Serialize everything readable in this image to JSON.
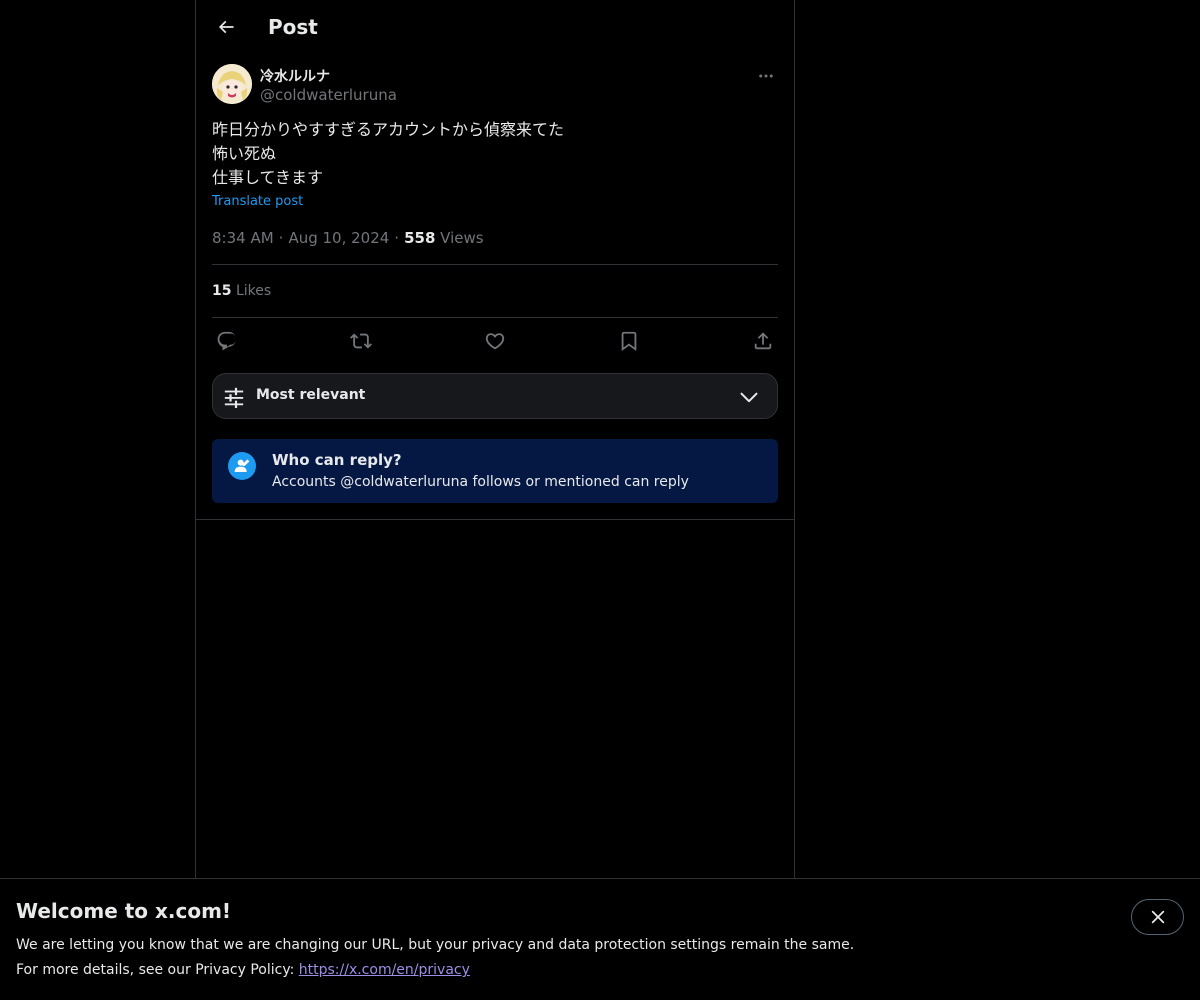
{
  "header": {
    "title": "Post",
    "back_icon": "arrow-left-icon"
  },
  "post": {
    "author_name": "冷水ルルナ",
    "author_handle": "@coldwaterluruna",
    "text_lines": [
      "昨日分かりやすすぎるアカウントから偵察来てた",
      "怖い死ぬ",
      "仕事してきます"
    ],
    "translate_label": "Translate post",
    "time": "8:34 AM",
    "date": "Aug 10, 2024",
    "views_count": "558",
    "views_label": "Views",
    "likes_count": "15",
    "likes_label": "Likes"
  },
  "sort": {
    "label": "Most relevant"
  },
  "reply_restriction": {
    "title": "Who can reply?",
    "description": "Accounts @coldwaterluruna follows or mentioned can reply"
  },
  "banner": {
    "title": "Welcome to x.com!",
    "line1": "We are letting you know that we are changing our URL, but your privacy and data protection settings remain the same.",
    "line2_prefix": "For more details, see our Privacy Policy: ",
    "link_text": "https://x.com/en/privacy"
  },
  "colors": {
    "accent": "#1d9bf0",
    "reply_box_bg": "#051843",
    "link": "#9b8fe6"
  }
}
